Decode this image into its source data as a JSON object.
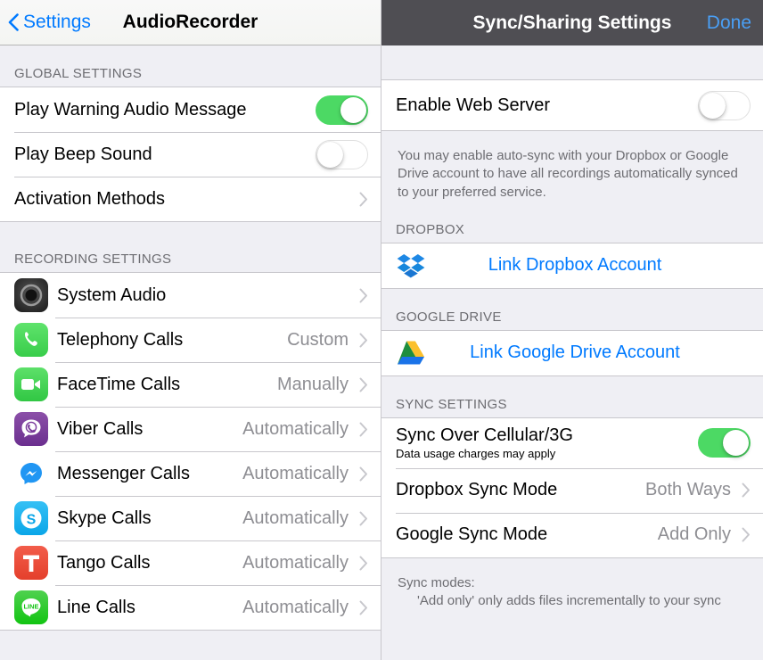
{
  "left": {
    "nav": {
      "back_label": "Settings",
      "title": "AudioRecorder"
    },
    "sections": [
      {
        "header": "GLOBAL SETTINGS",
        "rows": [
          {
            "title": "Play Warning Audio Message",
            "control": "switch",
            "state": "on"
          },
          {
            "title": "Play Beep Sound",
            "control": "switch",
            "state": "off"
          },
          {
            "title": "Activation Methods",
            "control": "chevron",
            "value": ""
          }
        ]
      },
      {
        "header": "RECORDING SETTINGS",
        "rows": [
          {
            "title": "System Audio",
            "value": "",
            "icon": "system-audio-icon"
          },
          {
            "title": "Telephony Calls",
            "value": "Custom",
            "icon": "phone-icon"
          },
          {
            "title": "FaceTime Calls",
            "value": "Manually",
            "icon": "facetime-icon"
          },
          {
            "title": "Viber Calls",
            "value": "Automatically",
            "icon": "viber-icon"
          },
          {
            "title": "Messenger Calls",
            "value": "Automatically",
            "icon": "messenger-icon"
          },
          {
            "title": "Skype Calls",
            "value": "Automatically",
            "icon": "skype-icon"
          },
          {
            "title": "Tango Calls",
            "value": "Automatically",
            "icon": "tango-icon"
          },
          {
            "title": "Line Calls",
            "value": "Automatically",
            "icon": "line-icon"
          }
        ]
      }
    ]
  },
  "right": {
    "nav": {
      "title": "Sync/Sharing Settings",
      "done_label": "Done"
    },
    "web_server": {
      "title": "Enable Web Server",
      "state": "off"
    },
    "intro_note": "You may enable auto-sync with your Dropbox or Google Drive account to have all recordings automatically synced to your preferred service.",
    "dropbox": {
      "header": "DROPBOX",
      "link_label": "Link Dropbox Account",
      "icon": "dropbox-icon"
    },
    "google": {
      "header": "GOOGLE DRIVE",
      "link_label": "Link Google Drive Account",
      "icon": "google-drive-icon"
    },
    "sync": {
      "header": "SYNC SETTINGS",
      "cellular": {
        "title": "Sync Over Cellular/3G",
        "subtitle": "Data usage charges may apply",
        "state": "on"
      },
      "dropbox_mode": {
        "title": "Dropbox Sync Mode",
        "value": "Both Ways"
      },
      "google_mode": {
        "title": "Google Sync Mode",
        "value": "Add Only"
      }
    },
    "sync_note_title": "Sync modes:",
    "sync_note_line": "'Add only' only adds files incrementally to your sync"
  },
  "colors": {
    "accent_blue": "#007aff",
    "done_blue": "#4a9ff5",
    "switch_green": "#4cd964",
    "nav_dark": "#4f4e53",
    "group_bg": "#efeff4",
    "separator": "#c8c7cc",
    "secondary_text": "#8e8e93"
  }
}
